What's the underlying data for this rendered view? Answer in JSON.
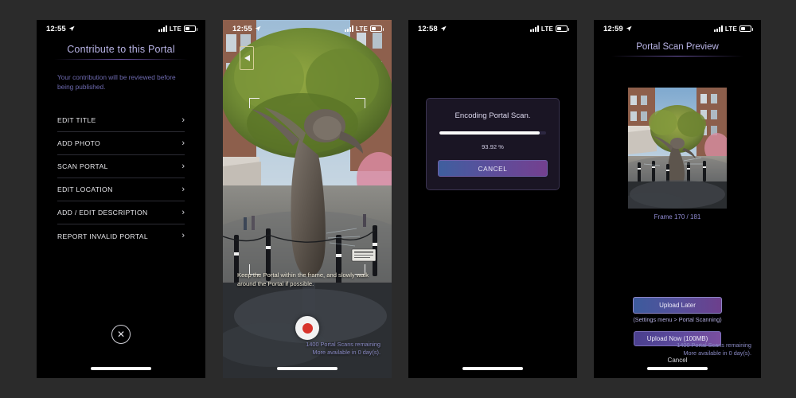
{
  "background_color": "#2b2b2b",
  "accent_color": "#b9b4e6",
  "panels": {
    "menu": {
      "status": {
        "time": "12:55",
        "network": "LTE"
      },
      "title": "Contribute to this Portal",
      "subtitle": "Your contribution will be reviewed before being published.",
      "items": [
        {
          "label": "EDIT TITLE",
          "chevron": "›"
        },
        {
          "label": "ADD PHOTO",
          "chevron": "›"
        },
        {
          "label": "SCAN PORTAL",
          "chevron": "›"
        },
        {
          "label": "EDIT LOCATION",
          "chevron": "›"
        },
        {
          "label": "ADD / EDIT DESCRIPTION",
          "chevron": "›"
        },
        {
          "label": "REPORT INVALID PORTAL",
          "chevron": "›"
        }
      ],
      "close_icon": "✕"
    },
    "camera": {
      "status": {
        "time": "12:55",
        "network": "LTE"
      },
      "orientation_icon": "phone-rotate-icon",
      "hint": "Keep the Portal within the frame, and slowly walk around the Portal if possible.",
      "record_icon": "record-button-icon",
      "scans_remaining": "1400 Portal Scans remaining",
      "scans_available": "More available in 0 day(s)."
    },
    "encoding": {
      "status": {
        "time": "12:58",
        "network": "LTE"
      },
      "dialog_title": "Encoding Portal Scan.",
      "percent_label": "93.92 %",
      "percent_value": 93.92,
      "cancel_label": "CANCEL"
    },
    "preview": {
      "status": {
        "time": "12:59",
        "network": "LTE"
      },
      "title": "Portal Scan Preview",
      "frame_label": "Frame 170 / 181",
      "frame_current": 170,
      "frame_total": 181,
      "upload_later_label": "Upload Later",
      "upload_note": "(Settings menu > Portal Scanning)",
      "upload_now_label": "Upload Now (100MB)",
      "cancel_label": "Cancel",
      "scans_remaining": "1400 Portal Scans remaining",
      "scans_available": "More available in 0 day(s)."
    }
  }
}
